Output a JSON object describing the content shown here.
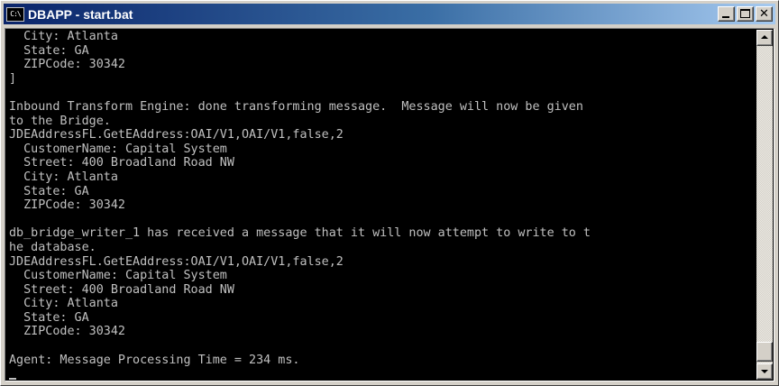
{
  "window": {
    "title": "DBAPP - start.bat",
    "icon": "cmd-console-icon",
    "icon_text": "C:\\"
  },
  "console": {
    "lines": [
      "  City: Atlanta",
      "  State: GA",
      "  ZIPCode: 30342",
      "]",
      "",
      "Inbound Transform Engine: done transforming message.  Message will now be given",
      "to the Bridge.",
      "JDEAddressFL.GetEAddress:OAI/V1,OAI/V1,false,2",
      "  CustomerName: Capital System",
      "  Street: 400 Broadland Road NW",
      "  City: Atlanta",
      "  State: GA",
      "  ZIPCode: 30342",
      "",
      "db_bridge_writer_1 has received a message that it will now attempt to write to t",
      "he database.",
      "JDEAddressFL.GetEAddress:OAI/V1,OAI/V1,false,2",
      "  CustomerName: Capital System",
      "  Street: 400 Broadland Road NW",
      "  City: Atlanta",
      "  State: GA",
      "  ZIPCode: 30342",
      "",
      "Agent: Message Processing Time = 234 ms.",
      ""
    ]
  },
  "colors": {
    "console_bg": "#000000",
    "console_fg": "#c0c0c0",
    "titlebar_start": "#0a246a",
    "titlebar_end": "#a6caf0"
  }
}
